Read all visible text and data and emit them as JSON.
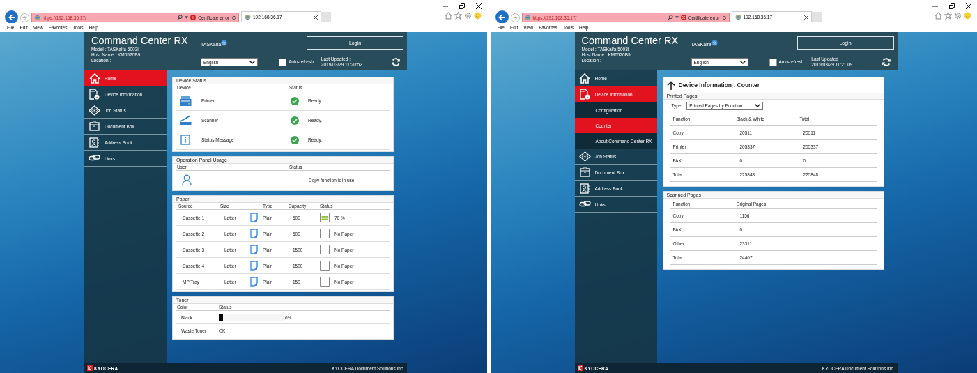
{
  "windows": [
    {
      "browser": {
        "url": "https://192.168.36.17/",
        "cert_error": "Certificate error",
        "tab_title": "192.168.36.17",
        "menu": [
          "File",
          "Edit",
          "View",
          "Favorites",
          "Tools",
          "Help"
        ]
      },
      "header": {
        "title": "Command Center RX",
        "brand": "TASKalfa",
        "model_label": "Model :",
        "model": "TASKalfa 5003i",
        "host_label": "Host Name :",
        "host": "KM6526B9",
        "location_label": "Location :",
        "language": "English",
        "auto_refresh": {
          "label": "Auto-refresh",
          "checked": false
        },
        "last_updated_label": "Last Updated :",
        "last_updated": "2019/03/29 11:20:52",
        "login": "Login"
      },
      "nav": [
        {
          "label": "Home",
          "selected": true
        },
        {
          "label": "Device Information",
          "selected": false
        },
        {
          "label": "Job Status",
          "selected": false
        },
        {
          "label": "Document Box",
          "selected": false
        },
        {
          "label": "Address Book",
          "selected": false
        },
        {
          "label": "Links",
          "selected": false
        }
      ],
      "page": {
        "kind": "home",
        "device_status": {
          "title": "Device Status",
          "columns": [
            "Device",
            "Status"
          ],
          "rows": [
            {
              "device": "Printer",
              "ok": true,
              "status": "Ready."
            },
            {
              "device": "Scanner",
              "ok": true,
              "status": "Ready."
            },
            {
              "device": "Status Message",
              "ok": true,
              "status": "Ready."
            }
          ]
        },
        "panel_usage": {
          "title": "Operation Panel Usage",
          "columns": [
            "User",
            "Status"
          ],
          "status": "Copy function is in use."
        },
        "paper": {
          "title": "Paper",
          "columns": [
            "Source",
            "Size",
            "Type",
            "Capacity",
            "Status"
          ],
          "rows": [
            {
              "source": "Cassette 1",
              "size": "Letter",
              "type": "Plain",
              "capacity": "500",
              "kind": "loaded",
              "status": "70 %"
            },
            {
              "source": "Cassette 2",
              "size": "Letter",
              "type": "Plain",
              "capacity": "500",
              "kind": "empty",
              "status": "No Paper"
            },
            {
              "source": "Cassette 3",
              "size": "Letter",
              "type": "Plain",
              "capacity": "1500",
              "kind": "empty",
              "status": "No Paper"
            },
            {
              "source": "Cassette 4",
              "size": "Letter",
              "type": "Plain",
              "capacity": "1500",
              "kind": "empty",
              "status": "No Paper"
            },
            {
              "source": "MP Tray",
              "size": "Letter",
              "type": "Plain",
              "capacity": "150",
              "kind": "empty",
              "status": "No Paper"
            }
          ]
        },
        "toner": {
          "title": "Toner",
          "columns": [
            "Color",
            "Status"
          ],
          "rows": [
            {
              "kind": "gauge",
              "name": "Black",
              "level": 0.06,
              "reading": "6%"
            },
            {
              "kind": "text",
              "name": "Waste Toner",
              "status": "OK"
            }
          ]
        }
      },
      "footer": {
        "logo": "KYOCERA",
        "company": "KYOCERA Document Solutions Inc."
      }
    },
    {
      "browser": {
        "url": "https://192.168.36.17/",
        "cert_error": "Certificate error",
        "tab_title": "192.168.36.17",
        "menu": [
          "File",
          "Edit",
          "View",
          "Favorites",
          "Tools",
          "Help"
        ]
      },
      "header": {
        "title": "Command Center RX",
        "brand": "TASKalfa",
        "model_label": "Model :",
        "model": "TASKalfa 5003i",
        "host_label": "Host Name :",
        "host": "KM6526B9",
        "location_label": "Location :",
        "language": "English",
        "auto_refresh": {
          "label": "Auto-refresh",
          "checked": false
        },
        "last_updated_label": "Last Updated :",
        "last_updated": "2019/03/29 11:21:09",
        "login": "Login"
      },
      "nav": [
        {
          "label": "Home",
          "selected": false
        },
        {
          "label": "Device Information",
          "selected": true,
          "children": [
            {
              "label": "Configuration",
              "selected": false
            },
            {
              "label": "Counter",
              "selected": true
            },
            {
              "label": "About Command Center RX",
              "selected": false
            }
          ]
        },
        {
          "label": "Job Status",
          "selected": false
        },
        {
          "label": "Document Box",
          "selected": false
        },
        {
          "label": "Address Book",
          "selected": false
        },
        {
          "label": "Links",
          "selected": false
        }
      ],
      "page": {
        "kind": "counter",
        "title": "Device Information : Counter",
        "printed": {
          "title": "Printed Pages",
          "type_label": "Type :",
          "type_value": "Printed Pages by Function",
          "columns": [
            "Function",
            "Black & White",
            "Total"
          ],
          "rows": [
            [
              "Copy",
              "20511",
              "20511"
            ],
            [
              "Printer",
              "205337",
              "205337"
            ],
            [
              "FAX",
              "0",
              "0"
            ],
            [
              "Total",
              "225848",
              "225848"
            ]
          ]
        },
        "scanned": {
          "title": "Scanned Pages",
          "columns": [
            "Function",
            "Original Pages"
          ],
          "rows": [
            [
              "Copy",
              "1156"
            ],
            [
              "FAX",
              "0"
            ],
            [
              "Other",
              "23311"
            ],
            [
              "Total",
              "24467"
            ]
          ]
        }
      },
      "footer": {
        "logo": "KYOCERA",
        "company": "KYOCERA Document Solutions Inc."
      }
    }
  ]
}
